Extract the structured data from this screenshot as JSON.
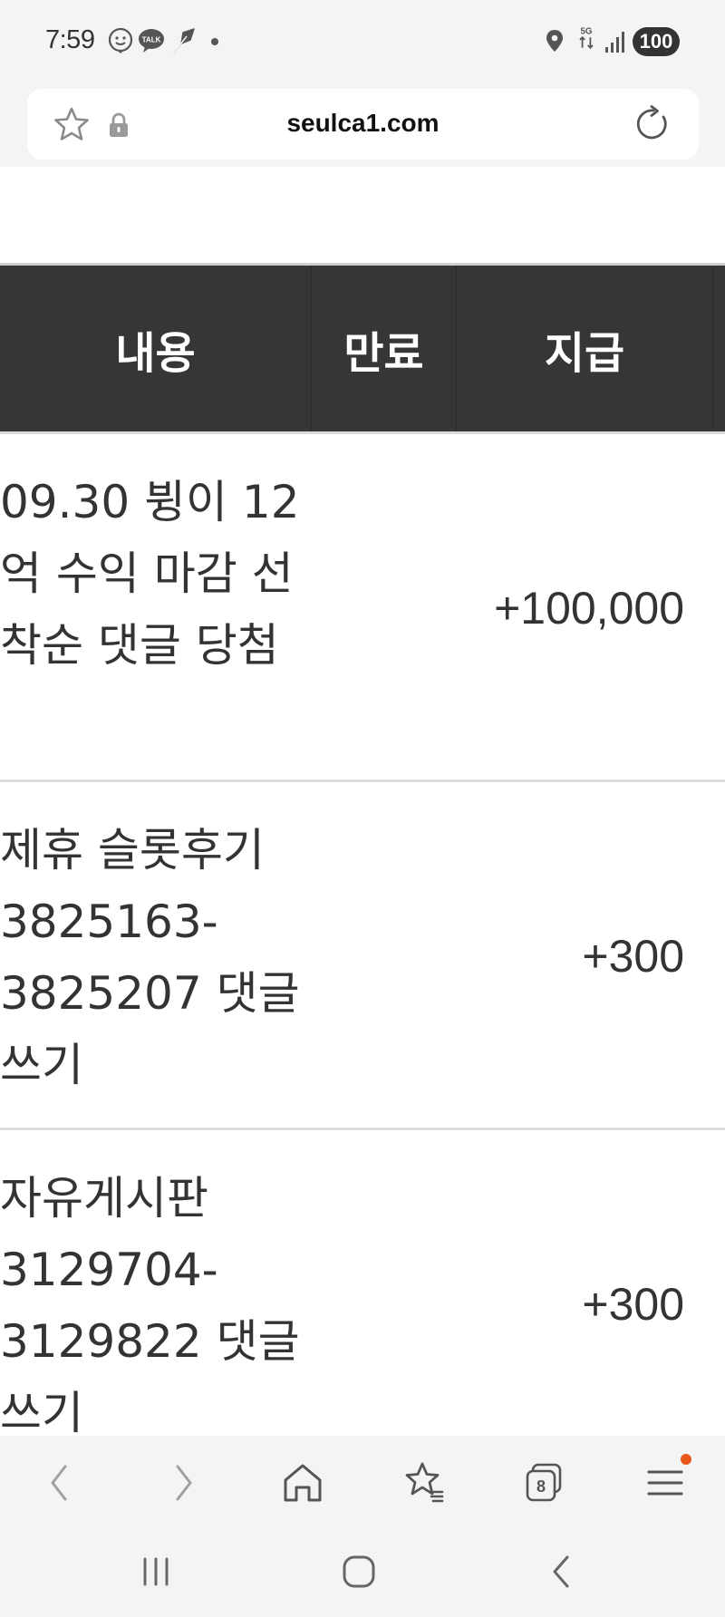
{
  "status_bar": {
    "time": "7:59",
    "notification_icons": [
      "face-icon",
      "talk-icon",
      "feather-icon",
      "dot-icon"
    ],
    "talk_label": "TALK",
    "network_label": "5G",
    "battery_level": "100"
  },
  "url_bar": {
    "url": "seulca1.com"
  },
  "table": {
    "headers": {
      "content": "내용",
      "expire": "만료",
      "pay": "지급"
    },
    "rows": [
      {
        "content": "09.30 뷩이 12억 수익 마감 선착순 댓글 당첨",
        "pay": "+100,000"
      },
      {
        "content": "제휴 슬롯후기 3825163-3825207 댓글쓰기",
        "pay": "+300"
      },
      {
        "content": "자유게시판 3129704-3129822 댓글쓰기",
        "pay": "+300"
      }
    ]
  },
  "browser_toolbar": {
    "tab_count": "8",
    "menu_badge_color": "#e8561a"
  },
  "colors": {
    "header_bg": "#363636",
    "page_bg": "#ffffff",
    "chrome_bg": "#f4f4f4"
  }
}
